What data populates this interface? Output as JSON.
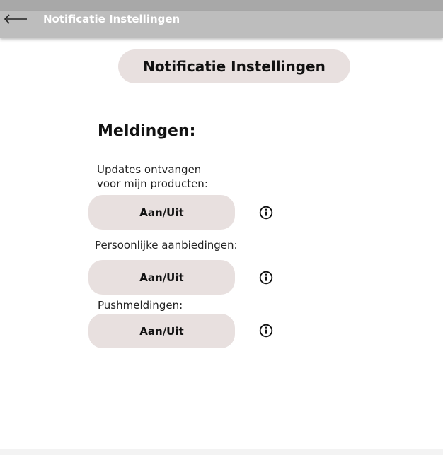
{
  "app_bar": {
    "back_icon": "arrow-left-icon",
    "title": "Notificatie Instellingen"
  },
  "page_title": "Notificatie Instellingen",
  "section": {
    "heading": "Meldingen:"
  },
  "settings": [
    {
      "label_line1": "Updates ontvangen",
      "label_line2": "voor mijn producten:",
      "button_label": "Aan/Uit",
      "info_icon": "info-icon"
    },
    {
      "label_line1": "Persoonlijke aanbiedingen:",
      "button_label": "Aan/Uit",
      "info_icon": "info-icon"
    },
    {
      "label_line1": "Pushmeldingen:",
      "button_label": "Aan/Uit",
      "info_icon": "info-icon"
    }
  ],
  "colors": {
    "app_bar": "#bdbdbd",
    "status_strip": "#a8a8a8",
    "pill_background": "#e8e0df",
    "text": "#111111"
  }
}
